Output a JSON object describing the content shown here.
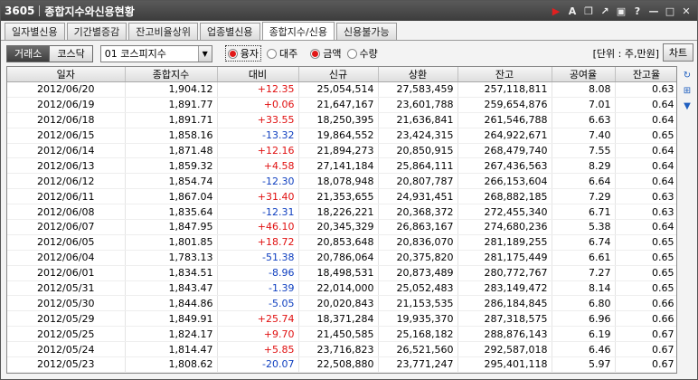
{
  "window": {
    "code": "3605",
    "title": "종합지수와신용현황",
    "icons": [
      "record-icon",
      "font-icon",
      "screen-add-icon",
      "link-icon",
      "window-icon",
      "help-icon",
      "minimize-icon",
      "maximize-icon",
      "close-icon"
    ]
  },
  "tabs": [
    {
      "label": "일자별신용",
      "active": false
    },
    {
      "label": "기간별증감",
      "active": false
    },
    {
      "label": "잔고비율상위",
      "active": false
    },
    {
      "label": "업종별신용",
      "active": false
    },
    {
      "label": "종합지수/신용",
      "active": true
    },
    {
      "label": "신용불가능",
      "active": false
    }
  ],
  "toolbar": {
    "market_on": "거래소",
    "market_off": "코스닥",
    "index_select": "01  코스피지수",
    "radio_yungja": "융자",
    "radio_daeju": "대주",
    "radio_amount": "금액",
    "radio_qty": "수량",
    "unit": "[단위 : 주,만원]",
    "chart_label": "차트"
  },
  "table": {
    "headers": [
      "일자",
      "종합지수",
      "대비",
      "신규",
      "상환",
      "잔고",
      "공여율",
      "잔고율"
    ],
    "rows": [
      [
        "2012/06/20",
        "1,904.12",
        "+12.35",
        "25,054,514",
        "27,583,459",
        "257,118,811",
        "8.08",
        "0.63"
      ],
      [
        "2012/06/19",
        "1,891.77",
        "+0.06",
        "21,647,167",
        "23,601,788",
        "259,654,876",
        "7.01",
        "0.64"
      ],
      [
        "2012/06/18",
        "1,891.71",
        "+33.55",
        "18,250,395",
        "21,636,841",
        "261,546,788",
        "6.63",
        "0.64"
      ],
      [
        "2012/06/15",
        "1,858.16",
        "-13.32",
        "19,864,552",
        "23,424,315",
        "264,922,671",
        "7.40",
        "0.65"
      ],
      [
        "2012/06/14",
        "1,871.48",
        "+12.16",
        "21,894,273",
        "20,850,915",
        "268,479,740",
        "7.55",
        "0.64"
      ],
      [
        "2012/06/13",
        "1,859.32",
        "+4.58",
        "27,141,184",
        "25,864,111",
        "267,436,563",
        "8.29",
        "0.64"
      ],
      [
        "2012/06/12",
        "1,854.74",
        "-12.30",
        "18,078,948",
        "20,807,787",
        "266,153,604",
        "6.64",
        "0.64"
      ],
      [
        "2012/06/11",
        "1,867.04",
        "+31.40",
        "21,353,655",
        "24,931,451",
        "268,882,185",
        "7.29",
        "0.63"
      ],
      [
        "2012/06/08",
        "1,835.64",
        "-12.31",
        "18,226,221",
        "20,368,372",
        "272,455,340",
        "6.71",
        "0.63"
      ],
      [
        "2012/06/07",
        "1,847.95",
        "+46.10",
        "20,345,329",
        "26,863,167",
        "274,680,236",
        "5.38",
        "0.64"
      ],
      [
        "2012/06/05",
        "1,801.85",
        "+18.72",
        "20,853,648",
        "20,836,070",
        "281,189,255",
        "6.74",
        "0.65"
      ],
      [
        "2012/06/04",
        "1,783.13",
        "-51.38",
        "20,786,064",
        "20,375,820",
        "281,175,449",
        "6.61",
        "0.65"
      ],
      [
        "2012/06/01",
        "1,834.51",
        "-8.96",
        "18,498,531",
        "20,873,489",
        "280,772,767",
        "7.27",
        "0.65"
      ],
      [
        "2012/05/31",
        "1,843.47",
        "-1.39",
        "22,014,000",
        "25,052,483",
        "283,149,472",
        "8.14",
        "0.65"
      ],
      [
        "2012/05/30",
        "1,844.86",
        "-5.05",
        "20,020,843",
        "21,153,535",
        "286,184,845",
        "6.80",
        "0.66"
      ],
      [
        "2012/05/29",
        "1,849.91",
        "+25.74",
        "18,371,284",
        "19,935,370",
        "287,318,575",
        "6.96",
        "0.66"
      ],
      [
        "2012/05/25",
        "1,824.17",
        "+9.70",
        "21,450,585",
        "25,168,182",
        "288,876,143",
        "6.19",
        "0.67"
      ],
      [
        "2012/05/24",
        "1,814.47",
        "+5.85",
        "23,716,823",
        "26,521,560",
        "292,587,018",
        "6.46",
        "0.67"
      ],
      [
        "2012/05/23",
        "1,808.62",
        "-20.07",
        "22,508,880",
        "23,771,247",
        "295,401,118",
        "5.97",
        "0.67"
      ]
    ]
  },
  "colors": {
    "up": "#e01010",
    "down": "#1040c0",
    "titlebar": "#4a4a4a"
  }
}
